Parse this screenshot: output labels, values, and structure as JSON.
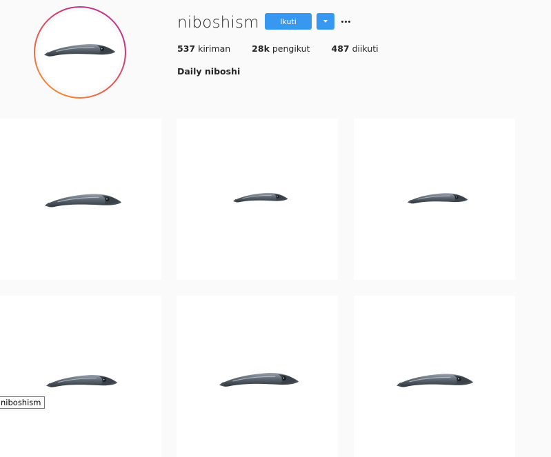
{
  "profile": {
    "username": "niboshism",
    "follow_label": "Ikuti",
    "bio": "Daily niboshi",
    "stats": [
      {
        "value": "537",
        "label": "kiriman"
      },
      {
        "value": "28k",
        "label": "pengikut"
      },
      {
        "value": "487",
        "label": "diikuti"
      }
    ]
  },
  "icons": {
    "dropdown": "chevron-down-icon",
    "more": "more-options-icon"
  },
  "posts": [
    {
      "alt": "dried sardine photo"
    },
    {
      "alt": "dried sardine photo"
    },
    {
      "alt": "dried sardine photo"
    },
    {
      "alt": "dried sardine photo"
    },
    {
      "alt": "dried sardine photo"
    },
    {
      "alt": "dried sardine photo"
    }
  ],
  "tooltip": "niboshism",
  "colors": {
    "accent": "#3897f0",
    "background": "#fafafa",
    "text": "#262626"
  }
}
